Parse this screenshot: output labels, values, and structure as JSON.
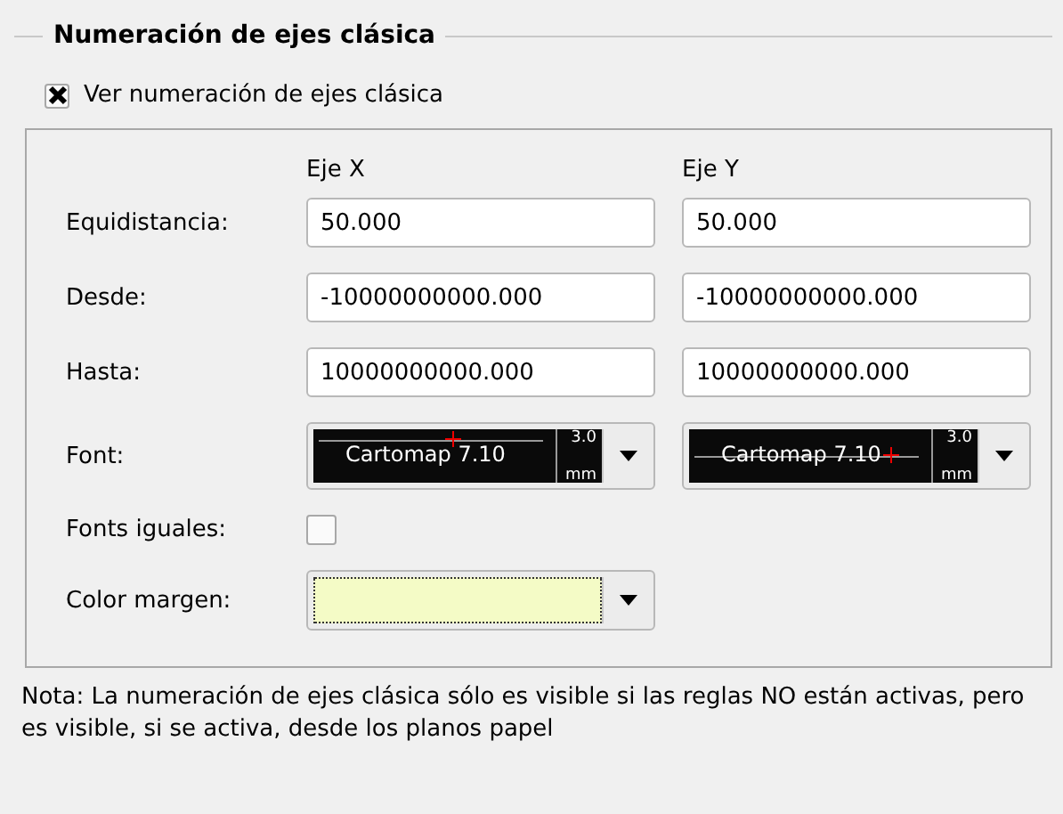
{
  "group": {
    "title": "Numeración de ejes clásica"
  },
  "show_checkbox": {
    "label": "Ver numeración de ejes clásica",
    "checked": true
  },
  "columns": [
    "Eje X",
    "Eje Y"
  ],
  "rows": [
    {
      "label": "Equidistancia:",
      "values": [
        "50.000",
        "50.000"
      ]
    },
    {
      "label": "Desde:",
      "values": [
        "-10000000000.000",
        "-10000000000.000"
      ]
    },
    {
      "label": "Hasta:",
      "values": [
        "10000000000.000",
        "10000000000.000"
      ]
    }
  ],
  "font": {
    "label": "Font:",
    "previews": [
      {
        "text": "Cartomap 7.10",
        "size": "3.0",
        "unit": "mm",
        "struck": false
      },
      {
        "text": "Cartomap 7.10",
        "size": "3.0",
        "unit": "mm",
        "struck": true
      }
    ]
  },
  "fonts_equal": {
    "label": "Fonts iguales:",
    "checked": false
  },
  "margin_color": {
    "label": "Color margen:",
    "color": "#f4fbc6"
  },
  "note": "Nota: La numeración de ejes clásica sólo es visible si las reglas NO están activas, pero es visible, si se activa, desde los planos papel"
}
